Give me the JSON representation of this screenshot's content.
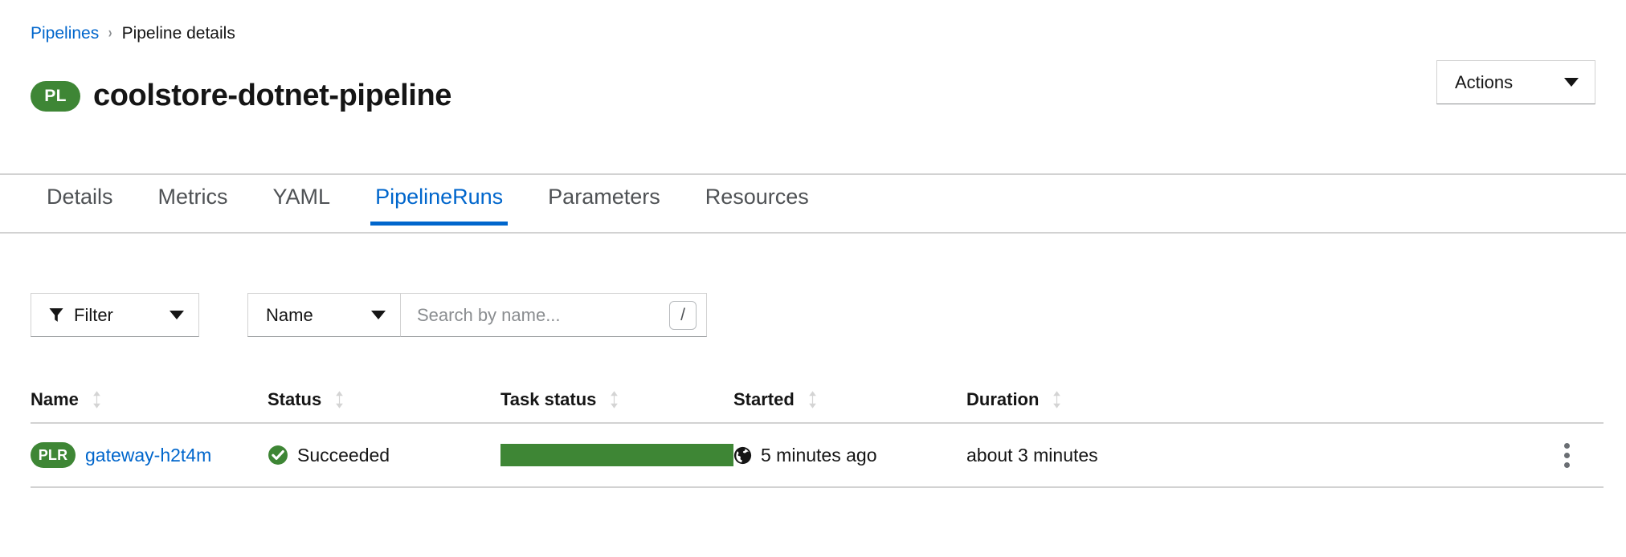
{
  "breadcrumb": {
    "parent": "Pipelines",
    "separator": "›",
    "current": "Pipeline details"
  },
  "header": {
    "badge": "PL",
    "title": "coolstore-dotnet-pipeline",
    "actions_label": "Actions"
  },
  "tabs": [
    {
      "label": "Details",
      "active": false
    },
    {
      "label": "Metrics",
      "active": false
    },
    {
      "label": "YAML",
      "active": false
    },
    {
      "label": "PipelineRuns",
      "active": true
    },
    {
      "label": "Parameters",
      "active": false
    },
    {
      "label": "Resources",
      "active": false
    }
  ],
  "toolbar": {
    "filter_label": "Filter",
    "attribute_label": "Name",
    "search_placeholder": "Search by name...",
    "search_value": "",
    "shortcut_key": "/"
  },
  "table": {
    "columns": [
      {
        "label": "Name",
        "sortable": true
      },
      {
        "label": "Status",
        "sortable": true
      },
      {
        "label": "Task status",
        "sortable": true
      },
      {
        "label": "Started",
        "sortable": true
      },
      {
        "label": "Duration",
        "sortable": true
      }
    ],
    "rows": [
      {
        "badge": "PLR",
        "name": "gateway-h2t4m",
        "status": "Succeeded",
        "task_status_percent": 100,
        "started": "5 minutes ago",
        "duration": "about 3 minutes"
      }
    ]
  },
  "colors": {
    "link_blue": "#0066cc",
    "success_green": "#3e8635",
    "text": "#151515",
    "muted": "#6a6e73",
    "border": "#d2d2d2"
  }
}
